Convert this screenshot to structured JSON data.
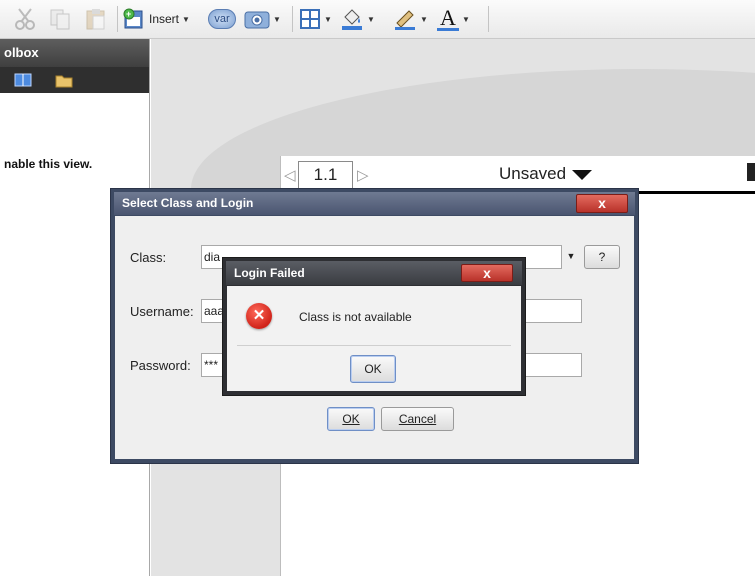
{
  "toolbar": {
    "insert_label": "Insert",
    "var_label": "var",
    "text_color_letter": "A"
  },
  "toolbox": {
    "title": "olbox",
    "message": "nable this view."
  },
  "document": {
    "page_number": "1.1",
    "title": "Unsaved"
  },
  "select_dialog": {
    "title": "Select Class and Login",
    "close_label": "x",
    "class_label": "Class:",
    "class_value": "dia",
    "help_label": "?",
    "username_label": "Username:",
    "username_value": "aaa",
    "password_label": "Password:",
    "password_value": "***",
    "ok_label": "OK",
    "cancel_label": "Cancel"
  },
  "login_failed": {
    "title": "Login Failed",
    "close_label": "x",
    "message": "Class is not available",
    "ok_label": "OK"
  },
  "colors": {
    "dialog_frame": "#3d4a63",
    "alert_frame": "#2e2f33",
    "close_red": "#c9392f",
    "error_red": "#d0231a"
  }
}
